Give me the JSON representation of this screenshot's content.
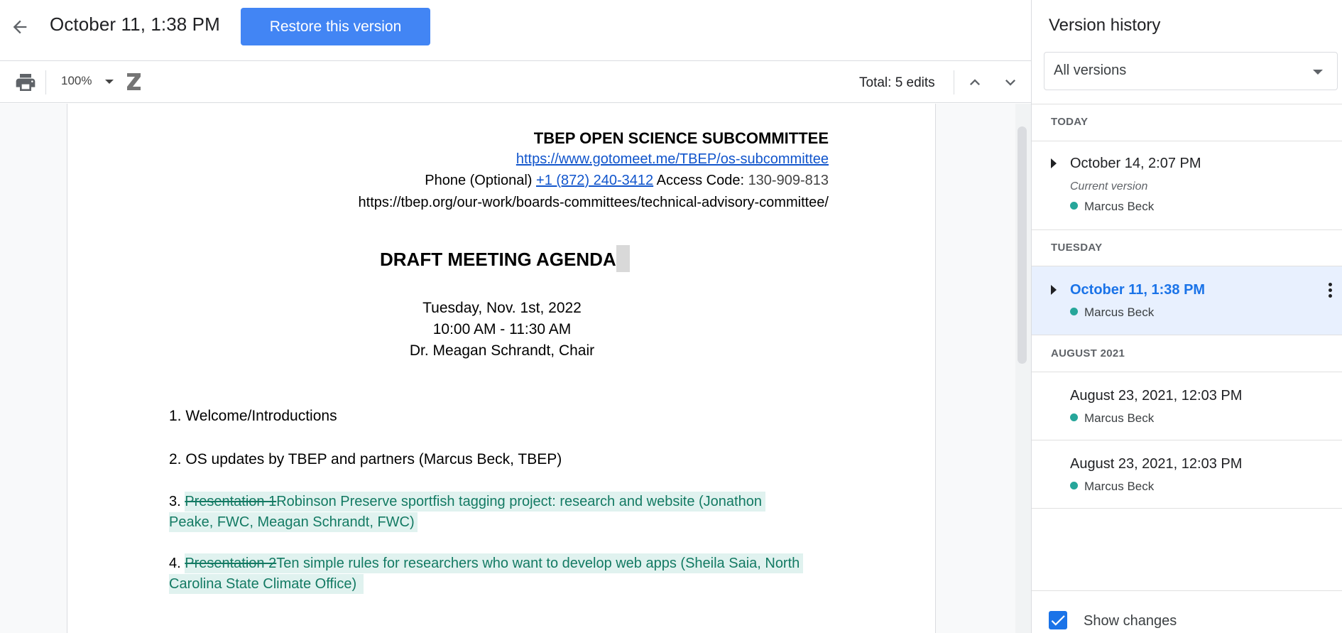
{
  "header": {
    "version_title": "October 11, 1:38 PM",
    "restore_label": "Restore this version"
  },
  "toolbar": {
    "zoom": "100%",
    "total_edits": "Total: 5 edits"
  },
  "document": {
    "org_title": "TBEP OPEN SCIENCE SUBCOMMITTEE",
    "meet_link": "https://www.gotomeet.me/TBEP/os-subcommittee",
    "phone_label": "Phone (Optional)",
    "phone_number": "+1 (872) 240-3412",
    "access_label": "Access Code:",
    "access_code": "130-909-813",
    "tbep_url": "https://tbep.org/our-work/boards-committees/technical-advisory-committee/",
    "agenda_title": "DRAFT MEETING AGENDA",
    "date": "Tuesday, Nov. 1st, 2022",
    "time": "10:00 AM - 11:30 AM",
    "chair": "Dr.  Meagan Schrandt, Chair",
    "items": [
      {
        "num": "1.",
        "text": "Welcome/Introductions"
      },
      {
        "num": "2.",
        "text": "OS updates by TBEP and partners (Marcus Beck, TBEP)"
      },
      {
        "num": "3.",
        "deleted": "Presentation 1",
        "inserted_line1": "Robinson Preserve sportfish tagging project: research and website (Jonathon",
        "inserted_line2": "Peake, FWC, Meagan Schrandt, FWC)"
      },
      {
        "num": "4.",
        "deleted": "Presentation 2",
        "inserted_line1": "Ten simple rules for researchers who want to develop web apps (Sheila Saia, North",
        "inserted_line2": "Carolina State Climate Office) "
      }
    ]
  },
  "panel": {
    "title": "Version history",
    "filter": "All versions",
    "groups": [
      {
        "heading": "TODAY"
      },
      {
        "heading": "TUESDAY"
      },
      {
        "heading": "AUGUST 2021"
      }
    ],
    "versions": [
      {
        "date": "October 14, 2:07 PM",
        "sub": "Current version",
        "author": "Marcus Beck"
      },
      {
        "date": "October 11, 1:38 PM",
        "author": "Marcus Beck"
      },
      {
        "date": "August 23, 2021, 12:03 PM",
        "author": "Marcus Beck"
      },
      {
        "date": "August 23, 2021, 12:03 PM",
        "author": "Marcus Beck"
      }
    ],
    "show_changes_label": "Show changes",
    "show_changes_checked": true
  },
  "colors": {
    "accent": "#4285f4",
    "selected_bg": "#e8f0fe",
    "author_dot": "#26a69a",
    "suggestion_text": "#137a63",
    "suggestion_bg": "#e0f2ef"
  }
}
